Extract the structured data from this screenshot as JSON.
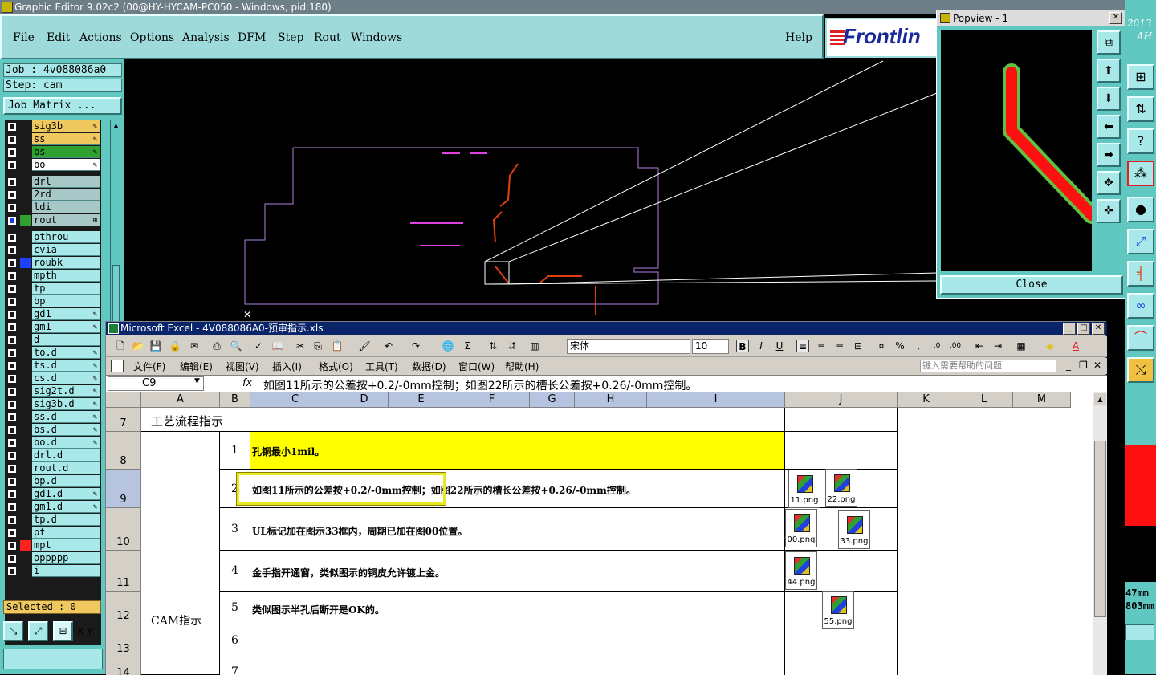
{
  "app": {
    "title": "Graphic Editor 9.02c2 (00@HY-HYCAM-PC050 - Windows, pid:180)",
    "menu": [
      "File",
      "Edit",
      "Actions",
      "Options",
      "Analysis",
      "DFM",
      "Step",
      "Rout",
      "Windows"
    ],
    "help": "Help",
    "logo": "Frontlin",
    "year_text": "2013",
    "ah_text": "AH"
  },
  "left": {
    "job": "Job : 4v088086a0",
    "step": "Step: cam",
    "job_matrix": "Job Matrix ...",
    "selected": "Selected : 0",
    "xy": "X Y",
    "layers": [
      {
        "name": "sig3b",
        "color": "#f0c860",
        "swatch": "",
        "mark": "✎"
      },
      {
        "name": "ss",
        "color": "#f0c860",
        "swatch": "",
        "mark": "✎"
      },
      {
        "name": "bs",
        "color": "#30a030",
        "swatch": "",
        "mark": "✎"
      },
      {
        "name": "bo",
        "color": "#ffffff",
        "swatch": "",
        "mark": "✎"
      },
      {
        "name": "drl",
        "color": "#a8c8c8",
        "swatch": "",
        "mark": ""
      },
      {
        "name": "2rd",
        "color": "#a8c8c8",
        "swatch": "",
        "mark": ""
      },
      {
        "name": "ldi",
        "color": "#a8c8c8",
        "swatch": "",
        "mark": ""
      },
      {
        "name": "rout",
        "color": "#a8c8c8",
        "swatch": "#30a030",
        "mark": "⊞"
      },
      {
        "name": "pthrou",
        "color": "#a8e8e8",
        "swatch": "",
        "mark": ""
      },
      {
        "name": "cvia",
        "color": "#a8e8e8",
        "swatch": "",
        "mark": ""
      },
      {
        "name": "roubk",
        "color": "#a8e8e8",
        "swatch": "#2040ff",
        "mark": ""
      },
      {
        "name": "mpth",
        "color": "#a8e8e8",
        "swatch": "",
        "mark": ""
      },
      {
        "name": "tp",
        "color": "#a8e8e8",
        "swatch": "",
        "mark": ""
      },
      {
        "name": "bp",
        "color": "#a8e8e8",
        "swatch": "",
        "mark": ""
      },
      {
        "name": "gd1",
        "color": "#a8e8e8",
        "swatch": "",
        "mark": "✎"
      },
      {
        "name": "gm1",
        "color": "#a8e8e8",
        "swatch": "",
        "mark": "✎"
      },
      {
        "name": "d",
        "color": "#a8e8e8",
        "swatch": "",
        "mark": ""
      },
      {
        "name": "to.d",
        "color": "#a8e8e8",
        "swatch": "",
        "mark": "✎"
      },
      {
        "name": "ts.d",
        "color": "#a8e8e8",
        "swatch": "",
        "mark": "✎"
      },
      {
        "name": "cs.d",
        "color": "#a8e8e8",
        "swatch": "",
        "mark": "✎"
      },
      {
        "name": "sig2t.d",
        "color": "#a8e8e8",
        "swatch": "",
        "mark": "✎"
      },
      {
        "name": "sig3b.d",
        "color": "#a8e8e8",
        "swatch": "",
        "mark": "✎"
      },
      {
        "name": "ss.d",
        "color": "#a8e8e8",
        "swatch": "",
        "mark": "✎"
      },
      {
        "name": "bs.d",
        "color": "#a8e8e8",
        "swatch": "",
        "mark": "✎"
      },
      {
        "name": "bo.d",
        "color": "#a8e8e8",
        "swatch": "",
        "mark": "✎"
      },
      {
        "name": "drl.d",
        "color": "#a8e8e8",
        "swatch": "",
        "mark": ""
      },
      {
        "name": "rout.d",
        "color": "#a8e8e8",
        "swatch": "",
        "mark": ""
      },
      {
        "name": "bp.d",
        "color": "#a8e8e8",
        "swatch": "",
        "mark": ""
      },
      {
        "name": "gd1.d",
        "color": "#a8e8e8",
        "swatch": "",
        "mark": "✎"
      },
      {
        "name": "gm1.d",
        "color": "#a8e8e8",
        "swatch": "",
        "mark": "✎"
      },
      {
        "name": "tp.d",
        "color": "#a8e8e8",
        "swatch": "",
        "mark": ""
      },
      {
        "name": "pt",
        "color": "#a8e8e8",
        "swatch": "",
        "mark": ""
      },
      {
        "name": "mpt",
        "color": "#a8e8e8",
        "swatch": "#ff2020",
        "mark": ""
      },
      {
        "name": "oppppp",
        "color": "#a8e8e8",
        "swatch": "",
        "mark": ""
      },
      {
        "name": "i",
        "color": "#a8e8e8",
        "swatch": "",
        "mark": ""
      }
    ]
  },
  "popview": {
    "title": "Popview - 1",
    "close": "Close"
  },
  "rightstrip": {
    "mm1": "47mm",
    "mm2": "803mm"
  },
  "excel": {
    "title": "Microsoft Excel - 4V088086A0-预审指示.xls",
    "font": "宋体",
    "size": "10",
    "menu": [
      "文件(F)",
      "编辑(E)",
      "视图(V)",
      "插入(I)",
      "格式(O)",
      "工具(T)",
      "数据(D)",
      "窗口(W)",
      "帮助(H)"
    ],
    "help_placeholder": "键入需要帮助的问题",
    "namebox": "C9",
    "fx": "fx",
    "formula": "如图11所示的公差按+0.2/-0mm控制；如图22所示的槽长公差按+0.26/-0mm控制。",
    "columns": [
      "A",
      "B",
      "C",
      "D",
      "E",
      "F",
      "G",
      "H",
      "I",
      "J",
      "K",
      "L",
      "M"
    ],
    "rows": [
      "7",
      "8",
      "9",
      "10",
      "11",
      "12",
      "13",
      "14"
    ],
    "section1": "工艺流程指示",
    "section2": "CAM指示",
    "items": [
      {
        "num": "1",
        "text": "孔铜最小1mil。"
      },
      {
        "num": "2",
        "text": "如图11所示的公差按+0.2/-0mm控制；如图22所示的槽长公差按+0.26/-0mm控制。"
      },
      {
        "num": "3",
        "text": "UL标记加在图示33框内，周期已加在图00位置。"
      },
      {
        "num": "4",
        "text": "金手指开通窗，类似图示的铜皮允许镀上金。"
      },
      {
        "num": "5",
        "text": "类似图示半孔后断开是OK的。"
      },
      {
        "num": "6",
        "text": ""
      },
      {
        "num": "7",
        "text": ""
      }
    ],
    "files": [
      "11.png",
      "22.png",
      "00.png",
      "33.png",
      "44.png",
      "55.png"
    ]
  }
}
